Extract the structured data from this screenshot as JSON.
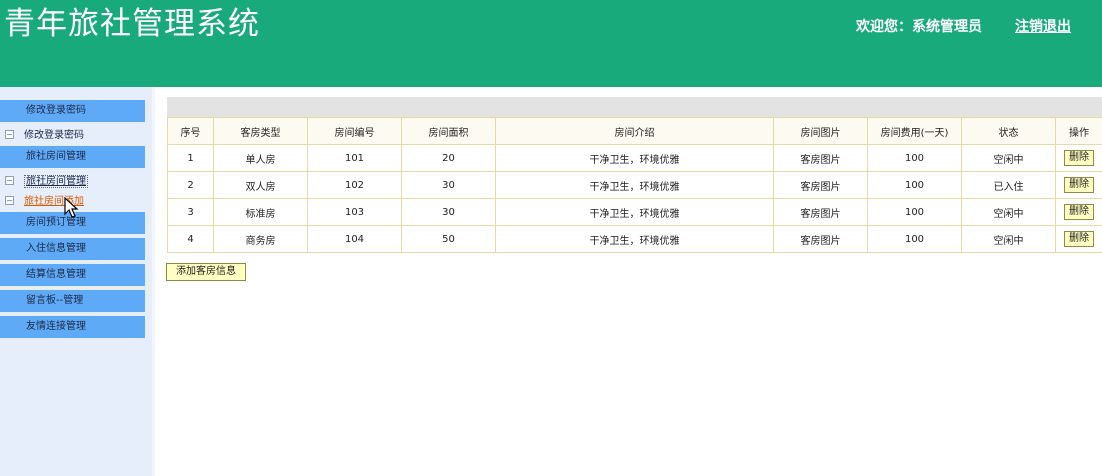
{
  "header": {
    "title": "青年旅社管理系统",
    "welcome": "欢迎您：系统管理员",
    "logout": "注销退出"
  },
  "sidebar": {
    "groups": [
      {
        "label": "修改登录密码",
        "items": [
          "修改登录密码"
        ]
      },
      {
        "label": "旅社房间管理",
        "items": [
          "旅社房间管理",
          "旅社房间添加"
        ]
      },
      {
        "label": "房间预订管理",
        "items": []
      },
      {
        "label": "入住信息管理",
        "items": []
      },
      {
        "label": "结算信息管理",
        "items": []
      },
      {
        "label": "留言板--管理",
        "items": []
      },
      {
        "label": "友情连接管理",
        "items": []
      }
    ]
  },
  "table": {
    "headers": [
      "序号",
      "客房类型",
      "房间编号",
      "房间面积",
      "房间介绍",
      "房间图片",
      "房间费用(一天)",
      "状态",
      "操作"
    ],
    "rows": [
      {
        "no": "1",
        "type": "单人房",
        "code": "101",
        "area": "20",
        "intro": "干净卫生，环境优雅",
        "image": "客房图片",
        "fee": "100",
        "status": "空闲中",
        "action": "删除"
      },
      {
        "no": "2",
        "type": "双人房",
        "code": "102",
        "area": "30",
        "intro": "干净卫生，环境优雅",
        "image": "客房图片",
        "fee": "100",
        "status": "已入住",
        "action": "删除"
      },
      {
        "no": "3",
        "type": "标准房",
        "code": "103",
        "area": "30",
        "intro": "干净卫生，环境优雅",
        "image": "客房图片",
        "fee": "100",
        "status": "空闲中",
        "action": "删除"
      },
      {
        "no": "4",
        "type": "商务房",
        "code": "104",
        "area": "50",
        "intro": "干净卫生，环境优雅",
        "image": "客房图片",
        "fee": "100",
        "status": "空闲中",
        "action": "删除"
      }
    ]
  },
  "add_button": "添加客房信息",
  "colors": {
    "header_bg": "#19aa7b",
    "menu_head_bg": "#5eaaf6",
    "status_occupied": "#1d9c2b"
  }
}
